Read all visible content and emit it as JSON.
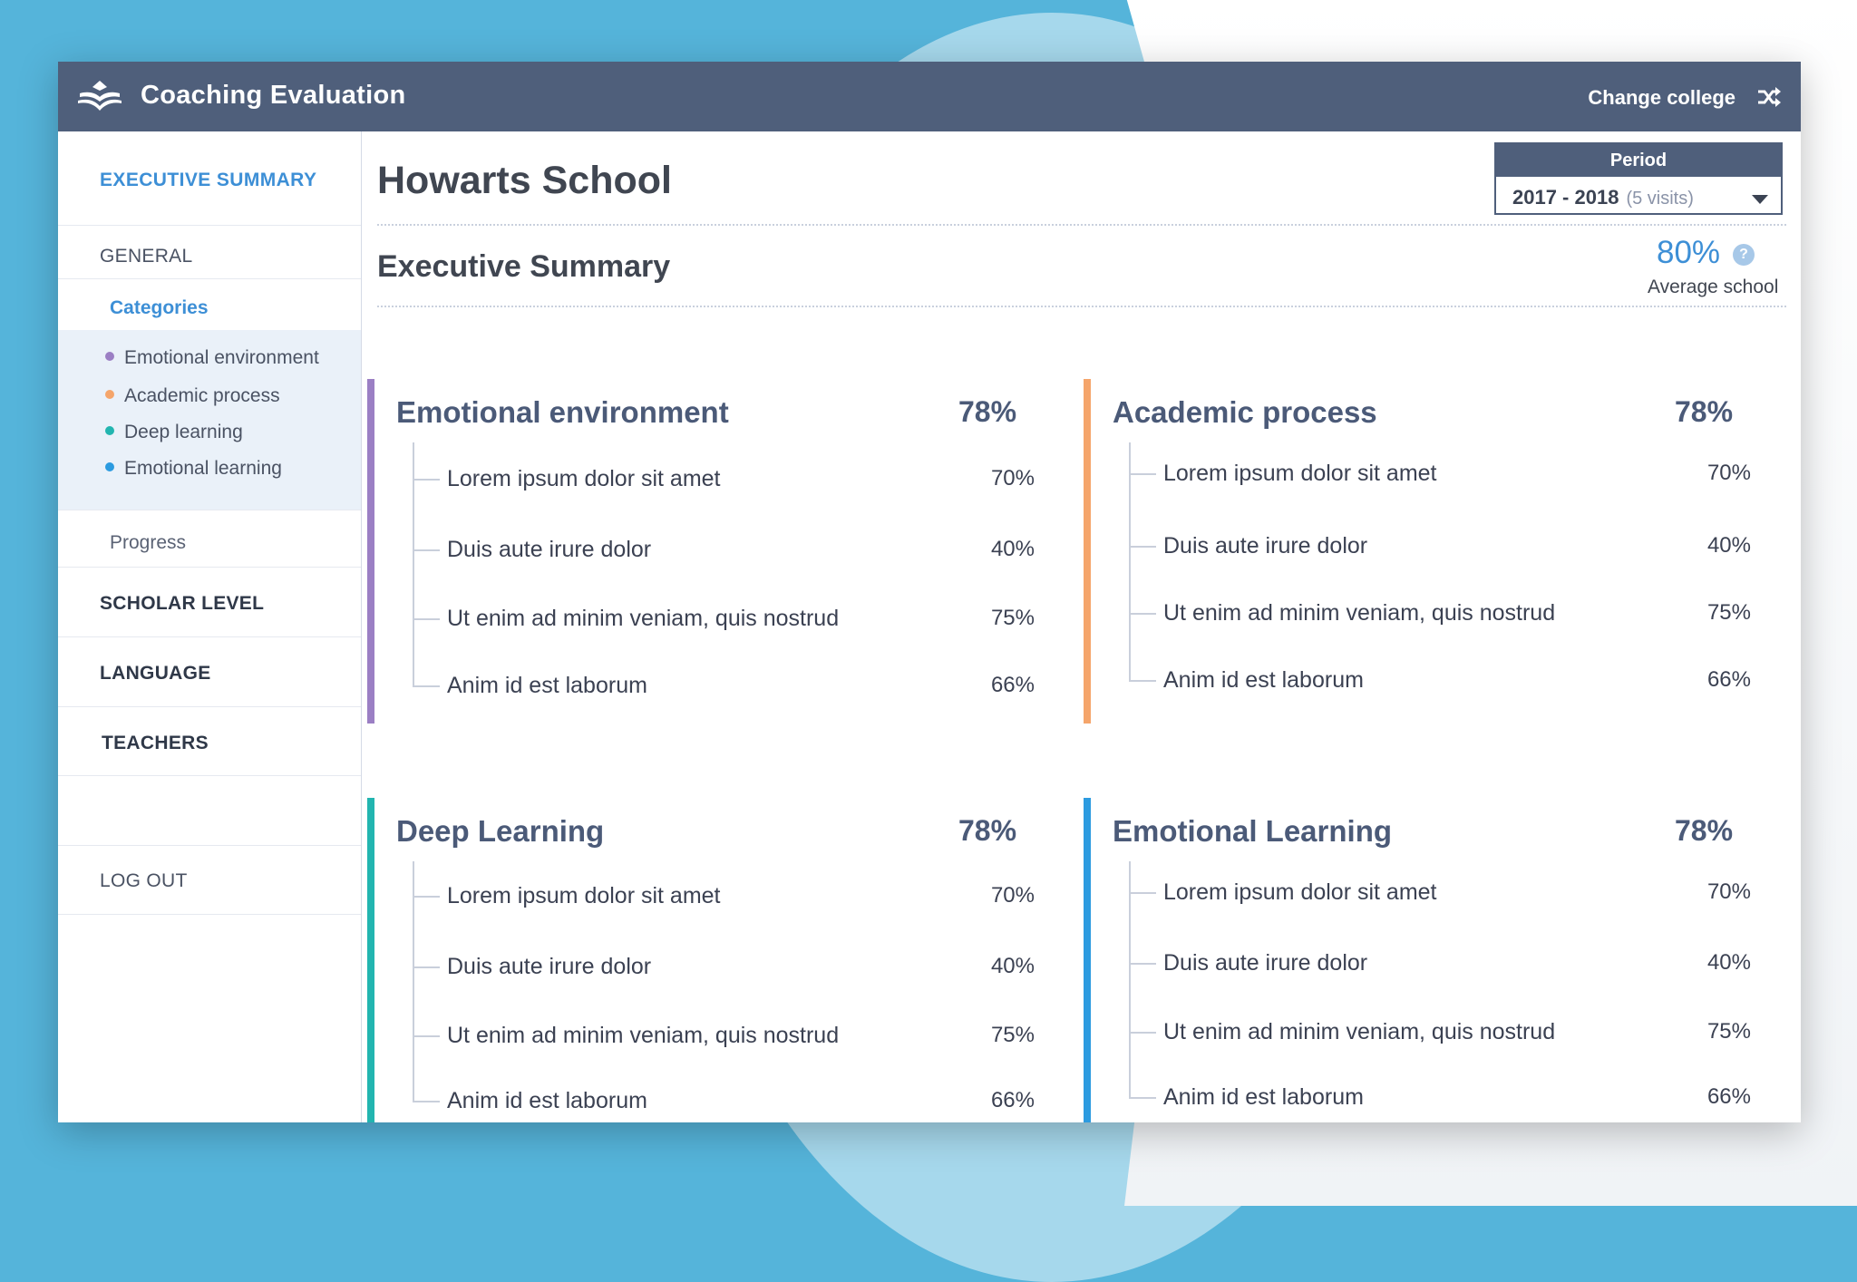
{
  "app": {
    "title": "Coaching Evaluation",
    "change_college": "Change college"
  },
  "sidebar": {
    "executive_summary": "EXECUTIVE SUMMARY",
    "general": "GENERAL",
    "categories_label": "Categories",
    "categories": [
      {
        "label": "Emotional environment",
        "color": "#9b7fc4"
      },
      {
        "label": "Academic process",
        "color": "#f5a56b"
      },
      {
        "label": "Deep learning",
        "color": "#22b5b0"
      },
      {
        "label": "Emotional learning",
        "color": "#2c9be0"
      }
    ],
    "progress": "Progress",
    "scholar_level": "SCHOLAR LEVEL",
    "language": "LANGUAGE",
    "teachers": "TEACHERS",
    "log_out": "LOG OUT"
  },
  "main": {
    "school_name": "Howarts School",
    "period": {
      "label": "Period",
      "value": "2017 - 2018",
      "visits": "(5 visits)"
    },
    "section_title": "Executive Summary",
    "average": {
      "value": "80%",
      "label": "Average school",
      "help": "?"
    },
    "cards": [
      {
        "title": "Emotional environment",
        "pct": "78%",
        "color": "#9b7fc4",
        "items": [
          {
            "label": "Lorem ipsum dolor sit amet",
            "value": "70%"
          },
          {
            "label": "Duis aute irure dolor",
            "value": "40%"
          },
          {
            "label": "Ut enim ad minim veniam, quis nostrud",
            "value": "75%"
          },
          {
            "label": "Anim id est laborum",
            "value": "66%"
          }
        ]
      },
      {
        "title": "Academic process",
        "pct": "78%",
        "color": "#f5a56b",
        "items": [
          {
            "label": "Lorem ipsum dolor sit amet",
            "value": "70%"
          },
          {
            "label": "Duis aute irure dolor",
            "value": "40%"
          },
          {
            "label": "Ut enim ad minim veniam, quis nostrud",
            "value": "75%"
          },
          {
            "label": "Anim id est laborum",
            "value": "66%"
          }
        ]
      },
      {
        "title": "Deep Learning",
        "pct": "78%",
        "color": "#22b5b0",
        "items": [
          {
            "label": "Lorem ipsum dolor sit amet",
            "value": "70%"
          },
          {
            "label": "Duis aute irure dolor",
            "value": "40%"
          },
          {
            "label": "Ut enim ad minim veniam, quis nostrud",
            "value": "75%"
          },
          {
            "label": "Anim id est laborum",
            "value": "66%"
          }
        ]
      },
      {
        "title": "Emotional Learning",
        "pct": "78%",
        "color": "#2c9be0",
        "items": [
          {
            "label": "Lorem ipsum dolor sit amet",
            "value": "70%"
          },
          {
            "label": "Duis aute irure dolor",
            "value": "40%"
          },
          {
            "label": "Ut enim ad minim veniam, quis nostrud",
            "value": "75%"
          },
          {
            "label": "Anim id est laborum",
            "value": "66%"
          }
        ]
      }
    ]
  }
}
